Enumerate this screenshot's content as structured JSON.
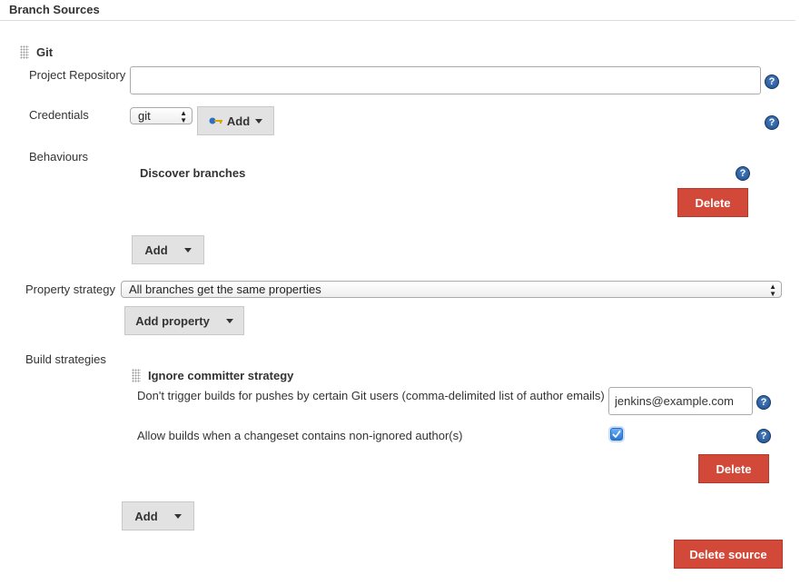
{
  "section": {
    "title": "Branch Sources"
  },
  "git": {
    "title": "Git",
    "project_repository": {
      "label": "Project Repository",
      "value": ""
    },
    "credentials": {
      "label": "Credentials",
      "selected": "git",
      "add_label": "Add"
    },
    "behaviours": {
      "label": "Behaviours",
      "items": [
        {
          "title": "Discover branches",
          "delete_label": "Delete"
        }
      ],
      "add_label": "Add"
    },
    "property_strategy": {
      "label": "Property strategy",
      "selected": "All branches get the same properties",
      "add_property_label": "Add property"
    },
    "build_strategies": {
      "label": "Build strategies",
      "items": [
        {
          "title": "Ignore committer strategy",
          "ignored_users_label": "Don't trigger builds for pushes by certain Git users (comma-delimited list of author emails)",
          "ignored_users_value": "jenkins@example.com",
          "allow_label": "Allow builds when a changeset contains non-ignored author(s)",
          "allow_checked": true,
          "delete_label": "Delete"
        }
      ],
      "add_label": "Add"
    },
    "delete_source_label": "Delete source"
  },
  "icons": {
    "help": "help-icon",
    "key": "key-icon",
    "grip": "drag-handle-icon",
    "caret": "caret-down-icon"
  },
  "help_glyph": "?",
  "colors": {
    "delete_button": "#d24939",
    "help_icon": "#1f4e8c",
    "gray_button": "#e2e2e2"
  }
}
